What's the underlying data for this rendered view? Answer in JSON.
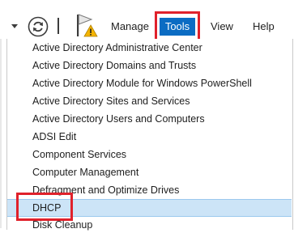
{
  "toolbar": {
    "menu": [
      "Manage",
      "Tools",
      "View",
      "Help"
    ],
    "active_menu": "Tools",
    "icons": [
      "chevron-down-icon",
      "refresh-icon",
      "flag-warning-icon"
    ]
  },
  "colors": {
    "accent": "#0b6cc3",
    "highlight_box": "#e0212b",
    "selected_row": "#cce4f7",
    "warning": "#f4b400"
  },
  "tools_menu": {
    "items": [
      "Active Directory Administrative Center",
      "Active Directory Domains and Trusts",
      "Active Directory Module for Windows PowerShell",
      "Active Directory Sites and Services",
      "Active Directory Users and Computers",
      "ADSI Edit",
      "Component Services",
      "Computer Management",
      "Defragment and Optimize Drives",
      "DHCP",
      "Disk Cleanup"
    ],
    "selected": "DHCP"
  }
}
